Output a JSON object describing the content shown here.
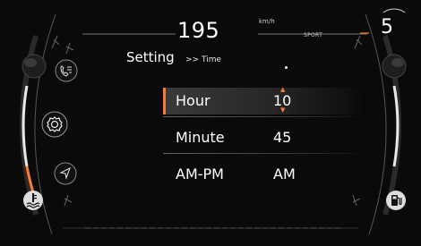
{
  "header": {
    "speed": "195",
    "speed_unit": "km/h",
    "drive_mode": "SPORT",
    "gear": "5"
  },
  "breadcrumb": {
    "title": "Setting",
    "separator": ">>",
    "current": "Time"
  },
  "time_settings": {
    "hour": {
      "label": "Hour",
      "value": "10"
    },
    "minute": {
      "label": "Minute",
      "value": "45"
    },
    "ampm": {
      "label": "AM-PM",
      "value": "AM"
    }
  },
  "icons": {
    "left": [
      "phone-list-icon",
      "settings-gear-icon",
      "navigation-arrow-icon",
      "coolant-temperature-icon"
    ],
    "right": [
      "fuel-pump-icon"
    ]
  },
  "colors": {
    "accent": "#ff7a2a",
    "background": "#0a0a0a",
    "text": "#ffffff"
  }
}
